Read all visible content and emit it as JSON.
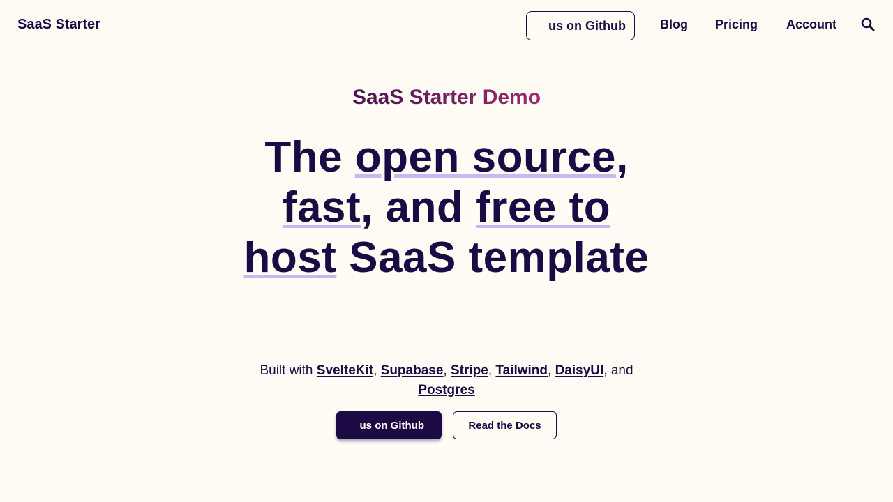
{
  "navbar": {
    "brand": "SaaS Starter",
    "github_button_label": "us on Github",
    "links": {
      "blog": "Blog",
      "pricing": "Pricing",
      "account": "Account"
    },
    "search_icon": "search-icon"
  },
  "hero": {
    "eyebrow": "SaaS Starter Demo",
    "headline": {
      "w1": "The",
      "w2": "open source",
      "w3": ",",
      "w4": "fast",
      "w5": ", and",
      "w6": "free to",
      "w7": "host",
      "w8": "SaaS template"
    },
    "built_with": {
      "prefix": "Built with",
      "sveltekit": "SvelteKit",
      "sep1": ",",
      "supabase": "Supabase",
      "sep2": ",",
      "stripe": "Stripe",
      "sep3": ",",
      "tailwind": "Tailwind",
      "sep4": ",",
      "daisyui": "DaisyUI",
      "sep5": ", and",
      "postgres": "Postgres"
    },
    "cta_primary": "us on Github",
    "cta_secondary": "Read the Docs"
  },
  "colors": {
    "background": "#fffbf5",
    "text": "#1b0a43",
    "underline_accent": "#c6b8f2",
    "eyebrow_gradient_start": "#4a1352",
    "eyebrow_gradient_end": "#9d2a6e"
  }
}
